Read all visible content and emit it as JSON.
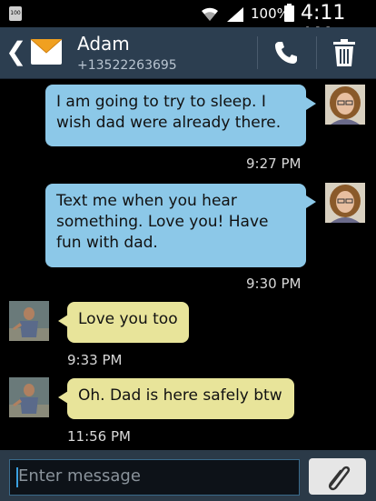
{
  "status_bar": {
    "notification_label": "100",
    "battery_percent": "100%",
    "time": "4:11 AM"
  },
  "header": {
    "contact_name": "Adam",
    "contact_number": "+13522263695"
  },
  "messages": [
    {
      "direction": "outgoing",
      "text": "I am going to try to sleep. I wish dad were already there.",
      "time": "9:27 PM"
    },
    {
      "direction": "outgoing",
      "text": "Text me when you hear something. Love you! Have fun with dad.",
      "time": "9:30 PM"
    },
    {
      "direction": "incoming",
      "text": "Love you too",
      "time": "9:33 PM"
    },
    {
      "direction": "incoming",
      "text": "Oh. Dad is here safely btw",
      "time": "11:56 PM"
    }
  ],
  "composer": {
    "placeholder": "Enter message"
  },
  "colors": {
    "header_bg": "#2c3e50",
    "outgoing_bubble": "#8cc8e8",
    "incoming_bubble": "#e8e49a",
    "input_bar_bg": "#2b3a48"
  },
  "icons": [
    "back-arrow-icon",
    "envelope-icon",
    "phone-icon",
    "trash-icon",
    "wifi-icon",
    "signal-icon",
    "battery-icon",
    "paperclip-icon"
  ]
}
